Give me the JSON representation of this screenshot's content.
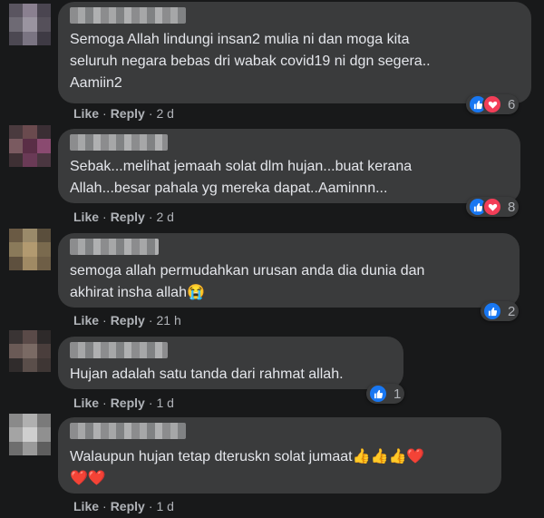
{
  "comments": [
    {
      "text": "Semoga Allah lindungi insan2 mulia ni dan moga kita\nseluruh negara bebas dri wabak covid19 ni dgn segera..\nAamiin2",
      "like": "Like",
      "reply": "Reply",
      "time": "2 d",
      "reactions": [
        "like",
        "love"
      ],
      "count": "6"
    },
    {
      "text": "Sebak...melihat jemaah solat dlm hujan...buat kerana\nAllah...besar pahala yg mereka dapat..Aaminnn...",
      "like": "Like",
      "reply": "Reply",
      "time": "2 d",
      "reactions": [
        "like",
        "love"
      ],
      "count": "8"
    },
    {
      "text": "semoga allah permudahkan urusan anda dia dunia dan\nakhirat insha allah",
      "emoji": "😭",
      "like": "Like",
      "reply": "Reply",
      "time": "21 h",
      "reactions": [
        "like"
      ],
      "count": "2"
    },
    {
      "text": "Hujan adalah satu tanda dari rahmat allah.",
      "like": "Like",
      "reply": "Reply",
      "time": "1 d",
      "reactions": [
        "like"
      ],
      "count": "1"
    },
    {
      "text": "Walaupun hujan tetap dteruskn solat jumaat",
      "emoji_line": "👍👍👍❤️",
      "emoji_line2": "❤️❤️",
      "like": "Like",
      "reply": "Reply",
      "time": "1 d",
      "reactions": [],
      "count": ""
    }
  ],
  "separator": "·",
  "colors": {
    "background": "#18191a",
    "bubble": "#3a3b3c",
    "like_blue": "#1877f2",
    "love_red": "#f33e58"
  }
}
